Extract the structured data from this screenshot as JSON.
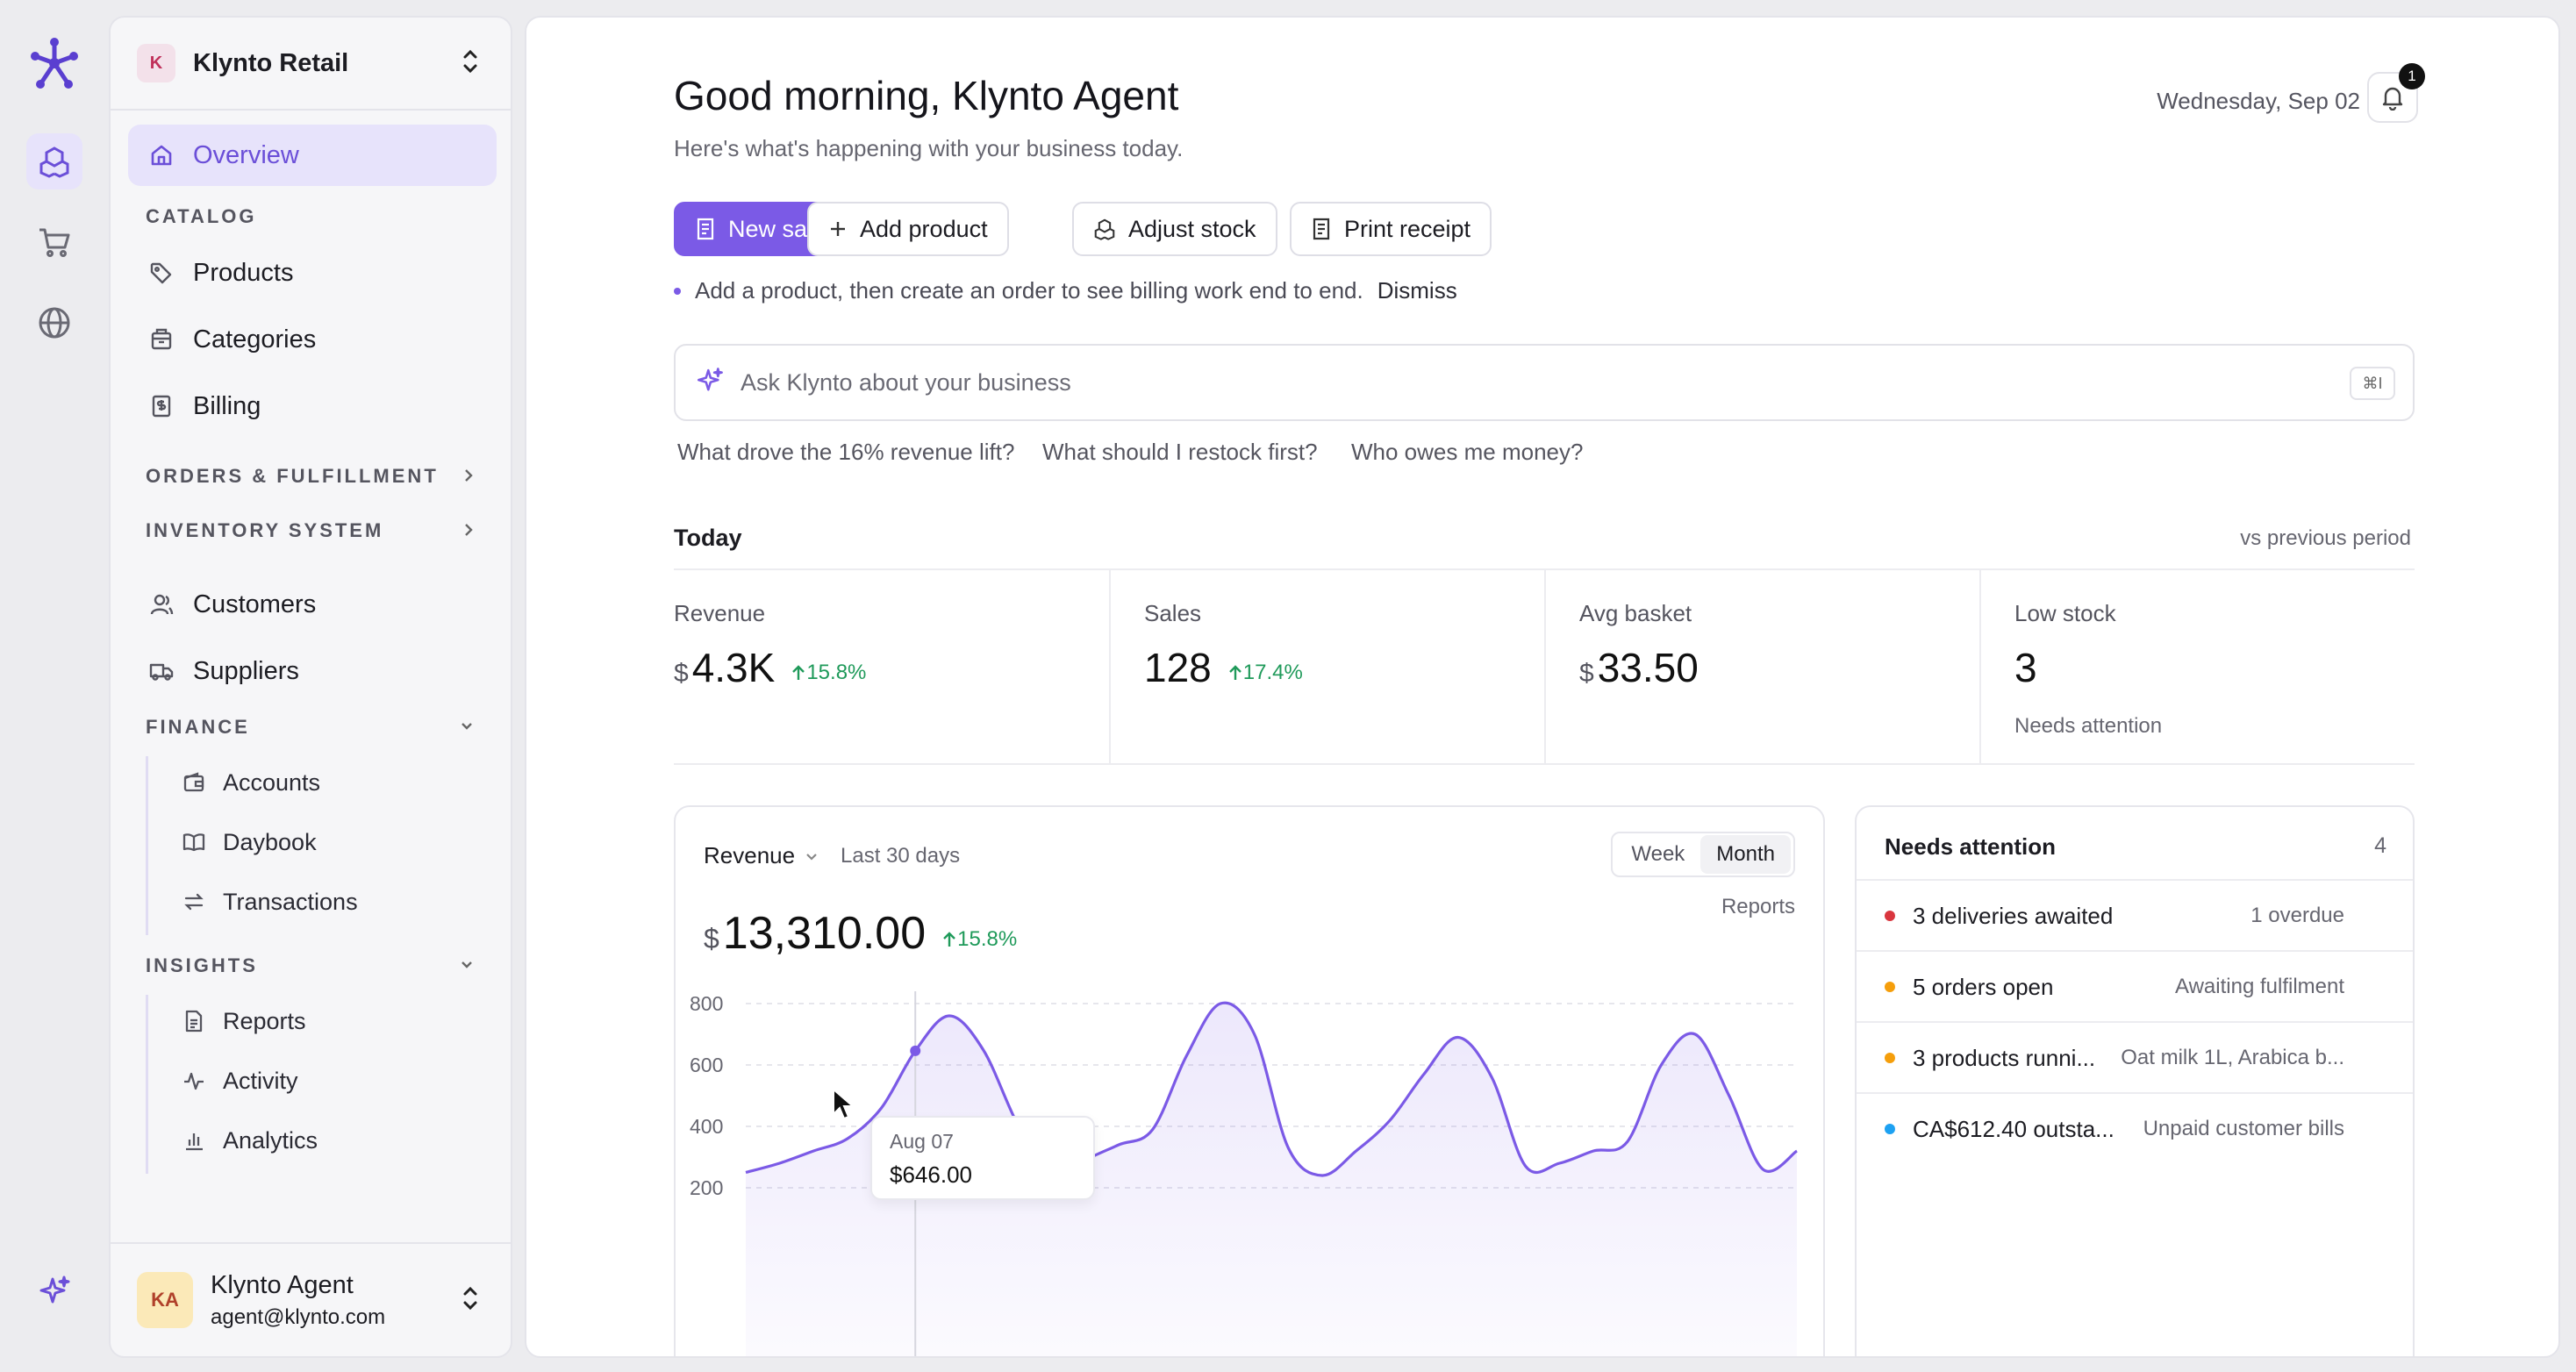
{
  "workspace": {
    "logo_letter": "K",
    "name": "Klynto Retail"
  },
  "nav": {
    "overview": "Overview",
    "catalog_section": "CATALOG",
    "products": "Products",
    "categories": "Categories",
    "billing": "Billing",
    "orders_section": "ORDERS & FULFILLMENT",
    "inventory_section": "INVENTORY SYSTEM",
    "customers": "Customers",
    "suppliers": "Suppliers",
    "finance_section": "FINANCE",
    "finance_items": [
      "Accounts",
      "Daybook",
      "Transactions"
    ],
    "insights_section": "INSIGHTS",
    "insights_items": [
      "Reports",
      "Activity",
      "Analytics"
    ]
  },
  "user": {
    "initials": "KA",
    "name": "Klynto Agent",
    "email": "agent@klynto.com"
  },
  "header": {
    "greeting": "Good morning, Klynto Agent",
    "subtitle": "Here's what's happening with your business today.",
    "date": "Wednesday, Sep 02",
    "notification_count": "1"
  },
  "actions": {
    "new_sale": "New sale",
    "add_product": "Add product",
    "adjust_stock": "Adjust stock",
    "print_receipt": "Print receipt"
  },
  "hint": {
    "text": "Add a product, then create an order to see billing work end to end.",
    "dismiss": "Dismiss"
  },
  "ask": {
    "placeholder": "Ask Klynto about your business",
    "shortcut": "⌘I"
  },
  "suggestions": [
    "What drove the 16% revenue lift?",
    "What should I restock first?",
    "Who owes me money?"
  ],
  "today": {
    "title": "Today",
    "compare": "vs previous period",
    "kpis": [
      {
        "label": "Revenue",
        "currency": "$",
        "value": "4.3K",
        "delta": "15.8%"
      },
      {
        "label": "Sales",
        "currency": "",
        "value": "128",
        "delta": "17.4%"
      },
      {
        "label": "Avg basket",
        "currency": "$",
        "value": "33.50",
        "delta": ""
      },
      {
        "label": "Low stock",
        "currency": "",
        "value": "3",
        "delta": "",
        "sub": "Needs attention"
      }
    ]
  },
  "revenue": {
    "metric": "Revenue",
    "range": "Last 30 days",
    "toggle": [
      "Week",
      "Month"
    ],
    "toggle_selected": "Month",
    "reports_link": "Reports",
    "currency": "$",
    "total": "13,310.00",
    "delta": "15.8%",
    "tooltip_label": "Aug 07",
    "tooltip_value": "$646.00",
    "accent": "#7b5ae6"
  },
  "chart_data": {
    "type": "area",
    "title": "",
    "xlabel": "",
    "ylabel": "",
    "ylim": [
      100,
      850
    ],
    "yticks": [
      200,
      400,
      600,
      800
    ],
    "grid": true,
    "series": [
      {
        "values": [
          250,
          280,
          320,
          360,
          460,
          646,
          760,
          650,
          410,
          230,
          290,
          340,
          390,
          630,
          800,
          700,
          330,
          240,
          320,
          420,
          570,
          690,
          560,
          270,
          280,
          320,
          350,
          600,
          700,
          500,
          260,
          320
        ]
      }
    ]
  },
  "attention": {
    "title": "Needs attention",
    "count": "4",
    "items": [
      {
        "text": "3 deliveries awaited",
        "meta": "1 overdue",
        "color": "#d9363e"
      },
      {
        "text": "5 orders open",
        "meta": "Awaiting fulfilment",
        "color": "#f59e0b"
      },
      {
        "text": "3 products runni...",
        "meta": "Oat milk 1L, Arabica b...",
        "color": "#f59e0b"
      },
      {
        "text": "CA$612.40 outsta...",
        "meta": "Unpaid customer bills",
        "color": "#1da1f2"
      }
    ]
  }
}
